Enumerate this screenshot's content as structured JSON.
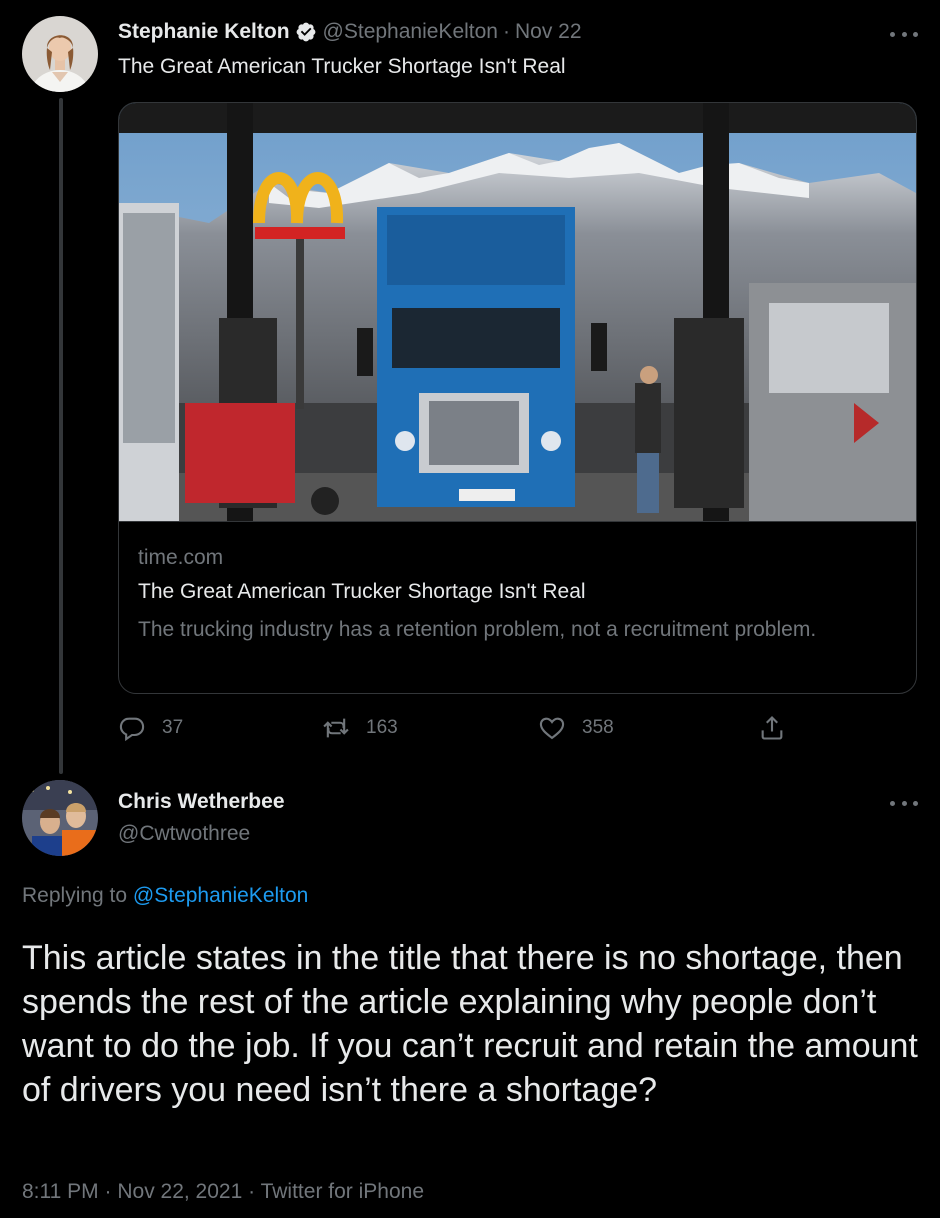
{
  "original_tweet": {
    "author": {
      "name": "Stephanie Kelton",
      "handle": "@StephanieKelton",
      "verified": true
    },
    "date": "Nov 22",
    "separator": "·",
    "text": "The Great American Trucker Shortage Isn't Real",
    "card": {
      "image_icon": "photo-truck-at-fuel-station",
      "domain": "time.com",
      "title": "The Great American Trucker Shortage Isn't Real",
      "description": "The trucking industry has a retention problem, not a recruitment problem."
    },
    "actions": {
      "replies": "37",
      "retweets": "163",
      "likes": "358"
    }
  },
  "reply_tweet": {
    "author": {
      "name": "Chris Wetherbee",
      "handle": "@Cwtwothree"
    },
    "replying_to_label": "Replying to",
    "replying_to_handle": "@StephanieKelton",
    "text": "This article states in the title that there is no shortage, then spends the rest of the article explaining why people don’t want to do the job.  If you can’t recruit and retain the amount of drivers you need isn’t there a shortage?",
    "time": "8:11 PM",
    "date": "Nov 22, 2021",
    "source": "Twitter for iPhone",
    "separator": "·"
  },
  "colors": {
    "background": "#000000",
    "text_primary": "#e7e9ea",
    "text_secondary": "#71767b",
    "link": "#1d9bf0",
    "border": "#333639",
    "verified": "#1d9bf0"
  },
  "icons": [
    "more-icon",
    "verified-badge-icon",
    "reply-icon",
    "retweet-icon",
    "like-icon",
    "share-icon"
  ]
}
